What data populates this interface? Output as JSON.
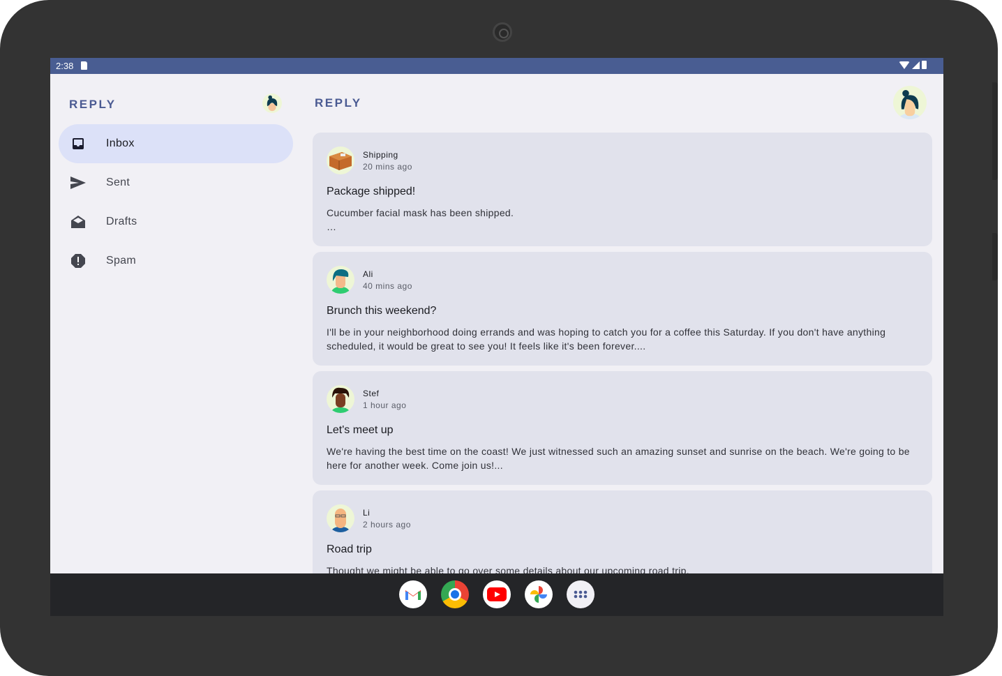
{
  "status_bar": {
    "time": "2:38"
  },
  "rail": {
    "brand": "REPLY",
    "items": [
      {
        "label": "Inbox",
        "icon": "inbox-icon",
        "active": true
      },
      {
        "label": "Sent",
        "icon": "send-icon"
      },
      {
        "label": "Drafts",
        "icon": "drafts-icon"
      },
      {
        "label": "Spam",
        "icon": "report-icon"
      }
    ]
  },
  "main": {
    "brand": "REPLY"
  },
  "emails": [
    {
      "sender": "Shipping",
      "time": "20 mins ago",
      "subject": "Package shipped!",
      "body": "Cucumber facial mask has been shipped.",
      "more": "…"
    },
    {
      "sender": "Ali",
      "time": "40 mins ago",
      "subject": "Brunch this weekend?",
      "body": "I'll be in your neighborhood doing errands and was hoping to catch you for a coffee this Saturday. If you don't have anything scheduled, it would be great to see you! It feels like it's been forever...."
    },
    {
      "sender": "Stef",
      "time": "1 hour ago",
      "subject": "Let's meet up",
      "body": "We're having the best time on the coast! We just witnessed such an amazing sunset and sunrise on the beach. We're going to be here for another week. Come join us!..."
    },
    {
      "sender": "Li",
      "time": "2 hours ago",
      "subject": "Road trip",
      "body": "Thought we might be able to go over some details about our upcoming road trip."
    }
  ],
  "dock": {
    "apps": [
      "Gmail",
      "Chrome",
      "YouTube",
      "Photos",
      "App drawer"
    ]
  },
  "colors": {
    "status_bar": "#495d92",
    "brand": "#4a5a92",
    "active_nav": "#dce1f8",
    "card": "#e1e2ec",
    "background": "#f1f0f5"
  }
}
